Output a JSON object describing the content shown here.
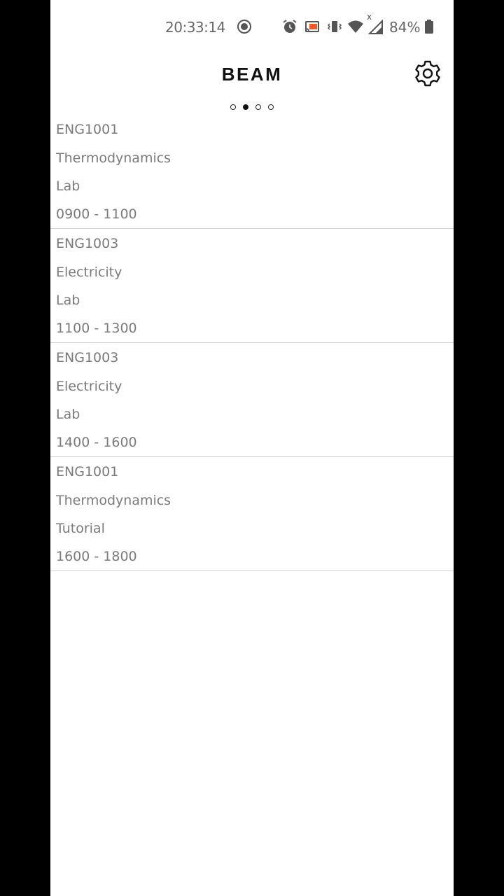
{
  "status_bar": {
    "time": "20:33:14",
    "battery": "84%",
    "icons": [
      "record-icon",
      "alarm-icon",
      "cast-icon",
      "vibrate-icon",
      "wifi-icon",
      "signal-icon",
      "battery-icon"
    ],
    "signal_mark": "x",
    "cast_color": "#f15a24"
  },
  "app": {
    "title": "BEAM",
    "settings_icon": "gear-icon"
  },
  "pager": {
    "count": 4,
    "active_index": 1
  },
  "schedule": [
    {
      "code": "ENG1001",
      "subject": "Thermodynamics",
      "type": "Lab",
      "time": "0900 - 1100"
    },
    {
      "code": "ENG1003",
      "subject": "Electricity",
      "type": "Lab",
      "time": "1100 - 1300"
    },
    {
      "code": "ENG1003",
      "subject": "Electricity",
      "type": "Lab",
      "time": "1400 - 1600"
    },
    {
      "code": "ENG1001",
      "subject": "Thermodynamics",
      "type": "Tutorial",
      "time": "1600 - 1800"
    }
  ]
}
